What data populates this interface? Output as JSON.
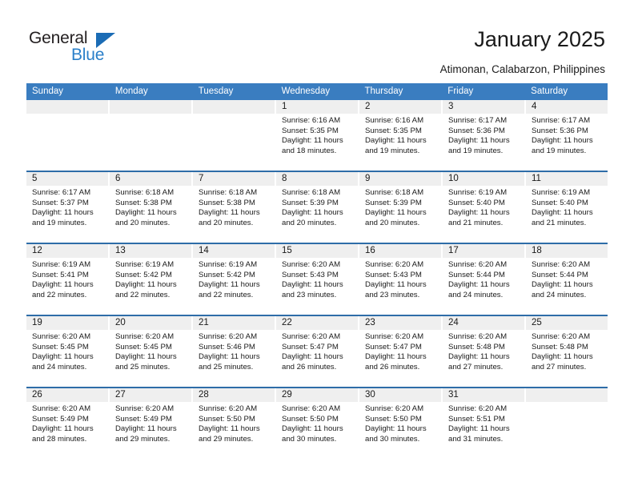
{
  "brand": {
    "name_top": "General",
    "name_bottom": "Blue",
    "accent_color": "#2a7fc9",
    "triangle_color": "#1b6cb5"
  },
  "header": {
    "title": "January 2025",
    "subtitle": "Atimonan, Calabarzon, Philippines"
  },
  "calendar": {
    "header_bg": "#3a7dc0",
    "row_divider_color": "#2e6da8",
    "daynum_bg": "#efefef",
    "weekdays": [
      "Sunday",
      "Monday",
      "Tuesday",
      "Wednesday",
      "Thursday",
      "Friday",
      "Saturday"
    ],
    "weeks": [
      [
        {
          "day": "",
          "empty": true
        },
        {
          "day": "",
          "empty": true
        },
        {
          "day": "",
          "empty": true
        },
        {
          "day": "1",
          "sunrise": "Sunrise: 6:16 AM",
          "sunset": "Sunset: 5:35 PM",
          "daylight": "Daylight: 11 hours and 18 minutes."
        },
        {
          "day": "2",
          "sunrise": "Sunrise: 6:16 AM",
          "sunset": "Sunset: 5:35 PM",
          "daylight": "Daylight: 11 hours and 19 minutes."
        },
        {
          "day": "3",
          "sunrise": "Sunrise: 6:17 AM",
          "sunset": "Sunset: 5:36 PM",
          "daylight": "Daylight: 11 hours and 19 minutes."
        },
        {
          "day": "4",
          "sunrise": "Sunrise: 6:17 AM",
          "sunset": "Sunset: 5:36 PM",
          "daylight": "Daylight: 11 hours and 19 minutes."
        }
      ],
      [
        {
          "day": "5",
          "sunrise": "Sunrise: 6:17 AM",
          "sunset": "Sunset: 5:37 PM",
          "daylight": "Daylight: 11 hours and 19 minutes."
        },
        {
          "day": "6",
          "sunrise": "Sunrise: 6:18 AM",
          "sunset": "Sunset: 5:38 PM",
          "daylight": "Daylight: 11 hours and 20 minutes."
        },
        {
          "day": "7",
          "sunrise": "Sunrise: 6:18 AM",
          "sunset": "Sunset: 5:38 PM",
          "daylight": "Daylight: 11 hours and 20 minutes."
        },
        {
          "day": "8",
          "sunrise": "Sunrise: 6:18 AM",
          "sunset": "Sunset: 5:39 PM",
          "daylight": "Daylight: 11 hours and 20 minutes."
        },
        {
          "day": "9",
          "sunrise": "Sunrise: 6:18 AM",
          "sunset": "Sunset: 5:39 PM",
          "daylight": "Daylight: 11 hours and 20 minutes."
        },
        {
          "day": "10",
          "sunrise": "Sunrise: 6:19 AM",
          "sunset": "Sunset: 5:40 PM",
          "daylight": "Daylight: 11 hours and 21 minutes."
        },
        {
          "day": "11",
          "sunrise": "Sunrise: 6:19 AM",
          "sunset": "Sunset: 5:40 PM",
          "daylight": "Daylight: 11 hours and 21 minutes."
        }
      ],
      [
        {
          "day": "12",
          "sunrise": "Sunrise: 6:19 AM",
          "sunset": "Sunset: 5:41 PM",
          "daylight": "Daylight: 11 hours and 22 minutes."
        },
        {
          "day": "13",
          "sunrise": "Sunrise: 6:19 AM",
          "sunset": "Sunset: 5:42 PM",
          "daylight": "Daylight: 11 hours and 22 minutes."
        },
        {
          "day": "14",
          "sunrise": "Sunrise: 6:19 AM",
          "sunset": "Sunset: 5:42 PM",
          "daylight": "Daylight: 11 hours and 22 minutes."
        },
        {
          "day": "15",
          "sunrise": "Sunrise: 6:20 AM",
          "sunset": "Sunset: 5:43 PM",
          "daylight": "Daylight: 11 hours and 23 minutes."
        },
        {
          "day": "16",
          "sunrise": "Sunrise: 6:20 AM",
          "sunset": "Sunset: 5:43 PM",
          "daylight": "Daylight: 11 hours and 23 minutes."
        },
        {
          "day": "17",
          "sunrise": "Sunrise: 6:20 AM",
          "sunset": "Sunset: 5:44 PM",
          "daylight": "Daylight: 11 hours and 24 minutes."
        },
        {
          "day": "18",
          "sunrise": "Sunrise: 6:20 AM",
          "sunset": "Sunset: 5:44 PM",
          "daylight": "Daylight: 11 hours and 24 minutes."
        }
      ],
      [
        {
          "day": "19",
          "sunrise": "Sunrise: 6:20 AM",
          "sunset": "Sunset: 5:45 PM",
          "daylight": "Daylight: 11 hours and 24 minutes."
        },
        {
          "day": "20",
          "sunrise": "Sunrise: 6:20 AM",
          "sunset": "Sunset: 5:45 PM",
          "daylight": "Daylight: 11 hours and 25 minutes."
        },
        {
          "day": "21",
          "sunrise": "Sunrise: 6:20 AM",
          "sunset": "Sunset: 5:46 PM",
          "daylight": "Daylight: 11 hours and 25 minutes."
        },
        {
          "day": "22",
          "sunrise": "Sunrise: 6:20 AM",
          "sunset": "Sunset: 5:47 PM",
          "daylight": "Daylight: 11 hours and 26 minutes."
        },
        {
          "day": "23",
          "sunrise": "Sunrise: 6:20 AM",
          "sunset": "Sunset: 5:47 PM",
          "daylight": "Daylight: 11 hours and 26 minutes."
        },
        {
          "day": "24",
          "sunrise": "Sunrise: 6:20 AM",
          "sunset": "Sunset: 5:48 PM",
          "daylight": "Daylight: 11 hours and 27 minutes."
        },
        {
          "day": "25",
          "sunrise": "Sunrise: 6:20 AM",
          "sunset": "Sunset: 5:48 PM",
          "daylight": "Daylight: 11 hours and 27 minutes."
        }
      ],
      [
        {
          "day": "26",
          "sunrise": "Sunrise: 6:20 AM",
          "sunset": "Sunset: 5:49 PM",
          "daylight": "Daylight: 11 hours and 28 minutes."
        },
        {
          "day": "27",
          "sunrise": "Sunrise: 6:20 AM",
          "sunset": "Sunset: 5:49 PM",
          "daylight": "Daylight: 11 hours and 29 minutes."
        },
        {
          "day": "28",
          "sunrise": "Sunrise: 6:20 AM",
          "sunset": "Sunset: 5:50 PM",
          "daylight": "Daylight: 11 hours and 29 minutes."
        },
        {
          "day": "29",
          "sunrise": "Sunrise: 6:20 AM",
          "sunset": "Sunset: 5:50 PM",
          "daylight": "Daylight: 11 hours and 30 minutes."
        },
        {
          "day": "30",
          "sunrise": "Sunrise: 6:20 AM",
          "sunset": "Sunset: 5:50 PM",
          "daylight": "Daylight: 11 hours and 30 minutes."
        },
        {
          "day": "31",
          "sunrise": "Sunrise: 6:20 AM",
          "sunset": "Sunset: 5:51 PM",
          "daylight": "Daylight: 11 hours and 31 minutes."
        },
        {
          "day": "",
          "empty": true
        }
      ]
    ]
  }
}
